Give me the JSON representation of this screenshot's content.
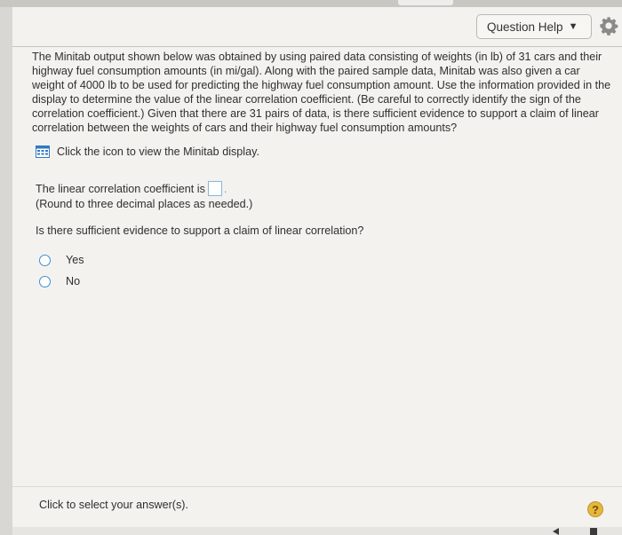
{
  "header": {
    "help_label": "Question Help",
    "help_caret_icon": "caret-down-icon",
    "settings_icon": "gear-icon"
  },
  "problem": {
    "text": "The Minitab output shown below was obtained by using paired data consisting of weights (in lb) of 31 cars and their highway fuel consumption amounts (in mi/gal). Along with the paired sample data, Minitab was also given a car weight of 4000 lb to be used for predicting the highway fuel consumption amount. Use the information provided in the display to determine the value of the linear correlation coefficient. (Be careful to correctly identify the sign of the correlation coefficient.) Given that there are 31 pairs of data, is there sufficient evidence to support a claim of linear correlation between the weights of cars and their highway fuel consumption amounts?",
    "display_link": "Click the icon to view the Minitab display."
  },
  "question1": {
    "prompt": "The linear correlation coefficient is",
    "answer_value": "",
    "period": ".",
    "note": "(Round to three decimal places as needed.)"
  },
  "question2": {
    "prompt": "Is there sufficient evidence to support a claim of linear correlation?",
    "options": [
      {
        "label": "Yes"
      },
      {
        "label": "No"
      }
    ]
  },
  "footer": {
    "instruction": "Click to select your answer(s).",
    "help_symbol": "?"
  },
  "colors": {
    "radio_border": "#3f8fd0",
    "help_circle": "#e3b83c",
    "grid_icon": "#2f78c4"
  }
}
